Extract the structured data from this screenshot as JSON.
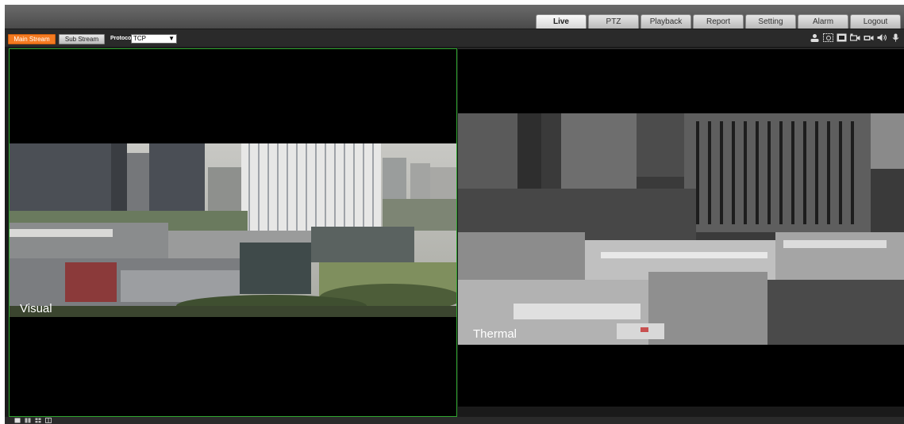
{
  "nav": {
    "tabs": [
      {
        "label": "Live",
        "active": true
      },
      {
        "label": "PTZ",
        "active": false
      },
      {
        "label": "Playback",
        "active": false
      },
      {
        "label": "Report",
        "active": false
      },
      {
        "label": "Setting",
        "active": false
      },
      {
        "label": "Alarm",
        "active": false
      },
      {
        "label": "Logout",
        "active": false
      }
    ]
  },
  "toolbar": {
    "main_stream_label": "Main Stream",
    "sub_stream_label": "Sub Stream",
    "protocol_label": "Protocol",
    "protocol_value": "TCP",
    "icons": [
      "user-icon",
      "fisheye-icon",
      "fullscreen-icon",
      "record-icon",
      "snapshot-icon",
      "audio-icon",
      "microphone-icon"
    ]
  },
  "panes": {
    "left": {
      "caption": "Visual"
    },
    "right": {
      "caption": "Thermal"
    }
  },
  "colors": {
    "accent": "#f47a20",
    "selected_border": "#2fa52f",
    "overlay_text": "#d62c2c"
  }
}
